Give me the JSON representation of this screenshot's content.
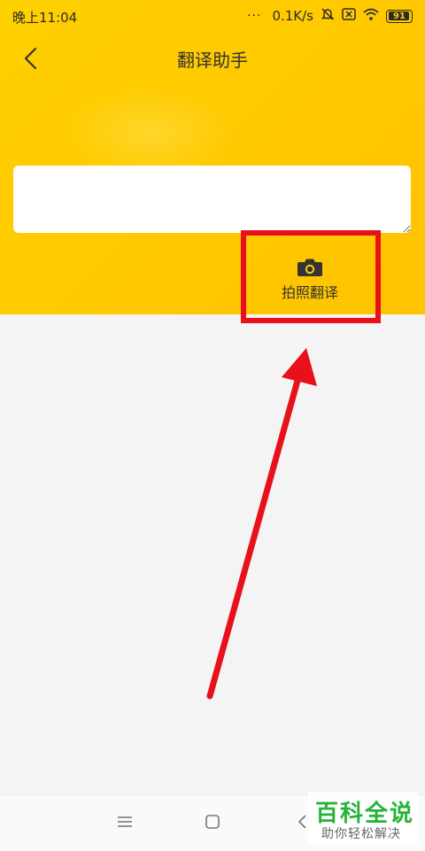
{
  "status_bar": {
    "time": "晚上11:04",
    "dots": "···",
    "net_speed": "0.1K/s",
    "battery": "91"
  },
  "header": {
    "title": "翻译助手"
  },
  "translate_input": {
    "value": "",
    "placeholder": ""
  },
  "photo_translate": {
    "label": "拍照翻译"
  },
  "annotation": {
    "highlight_color": "#e8101a"
  },
  "watermark": {
    "title": "百科全说",
    "subtitle": "助你轻松解决"
  },
  "colors": {
    "header_yellow": "#ffd000",
    "content_bg": "#f4f4f4",
    "watermark_green": "#27b339"
  },
  "icons": {
    "back": "chevron-left-icon",
    "camera": "camera-icon",
    "nav_menu": "menu-icon",
    "nav_home": "home-square-icon",
    "nav_back": "back-triangle-icon"
  }
}
